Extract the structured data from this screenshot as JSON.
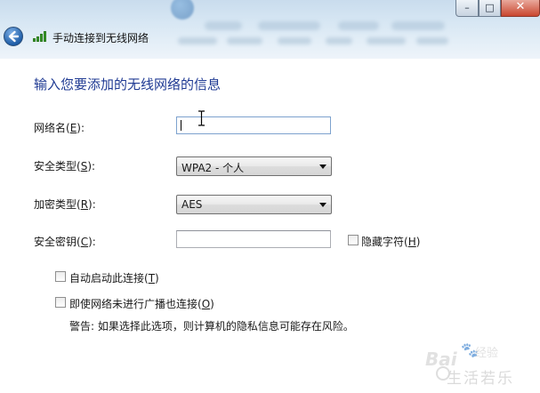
{
  "window": {
    "title": "手动连接到无线网络",
    "controls": {
      "minimize": "–",
      "maximize": "□",
      "close": "✕"
    }
  },
  "heading": "输入您要添加的无线网络的信息",
  "fields": {
    "network_name": {
      "label_text": "网络名",
      "accel": "E",
      "value": ""
    },
    "security_type": {
      "label_text": "安全类型",
      "accel": "S",
      "value": "WPA2 - 个人"
    },
    "encryption_type": {
      "label_text": "加密类型",
      "accel": "R",
      "value": "AES"
    },
    "security_key": {
      "label_text": "安全密钥",
      "accel": "C",
      "value": ""
    }
  },
  "hide_characters": {
    "label_text": "隐藏字符",
    "accel": "H",
    "checked": false
  },
  "options": {
    "auto_start": {
      "label_text": "自动启动此连接",
      "accel": "T",
      "checked": false
    },
    "connect_hidden": {
      "label_text": "即使网络未进行广播也连接",
      "accel": "O",
      "checked": false
    }
  },
  "warning": "警告: 如果选择此选项，则计算机的隐私信息可能存在风险。",
  "watermark": {
    "brand": "Bai",
    "paw": "🐾",
    "brand_suffix": "经验",
    "site": "生活若乐"
  },
  "icons": {
    "back": "back-arrow-icon",
    "wifi": "wifi-signal-icon",
    "dropdown": "chevron-down-icon",
    "cursor": "text-ibeam-cursor-icon"
  },
  "colors": {
    "heading": "#1f3a93",
    "signal": "#3b9c2d",
    "close_button": "#c9462f"
  }
}
